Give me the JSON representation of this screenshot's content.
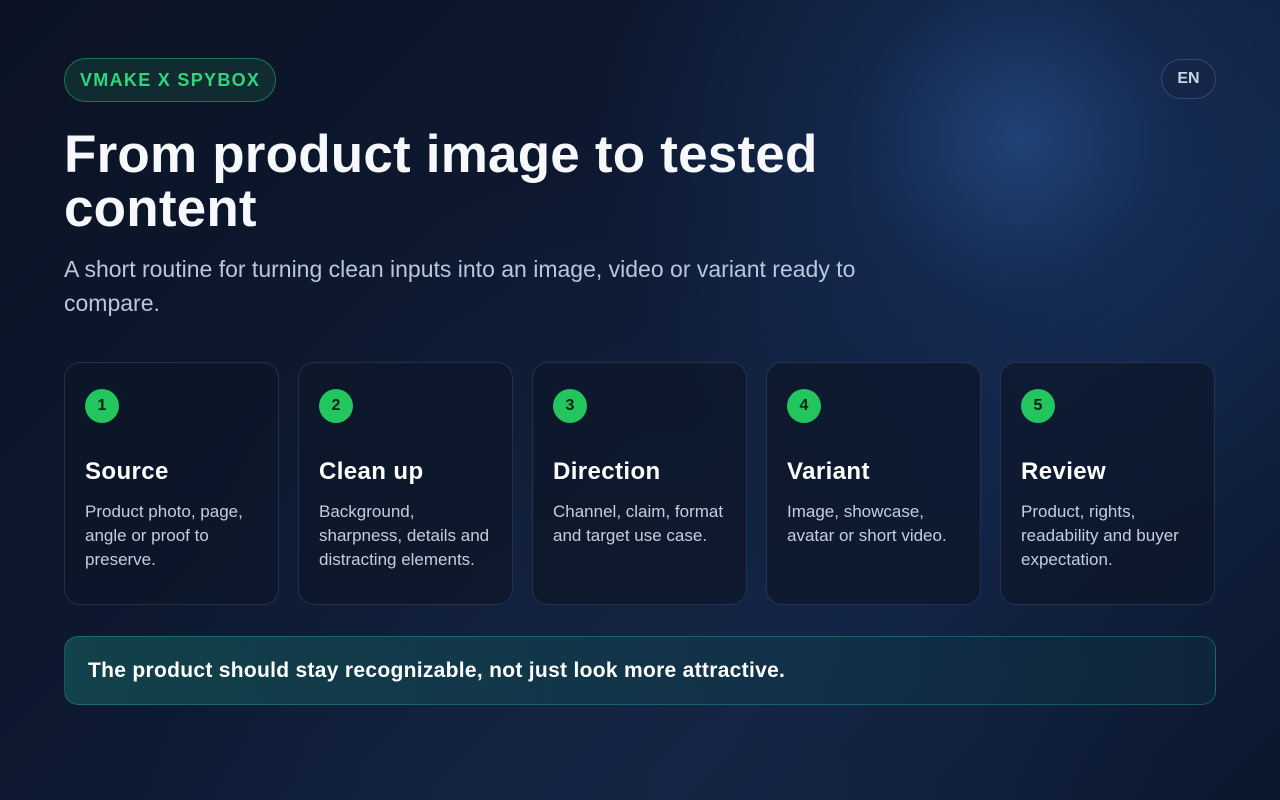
{
  "header": {
    "badge": "VMAKE X SPYBOX",
    "language": "EN"
  },
  "hero": {
    "title": "From product image to tested content",
    "subtitle": "A short routine for turning clean inputs into an image, video or variant ready to compare."
  },
  "steps": [
    {
      "number": "1",
      "title": "Source",
      "text": "Product photo, page, angle or proof to preserve."
    },
    {
      "number": "2",
      "title": "Clean up",
      "text": "Background, sharpness, details and distracting elements."
    },
    {
      "number": "3",
      "title": "Direction",
      "text": "Channel, claim, format and target use case."
    },
    {
      "number": "4",
      "title": "Variant",
      "text": "Image, showcase, avatar or short video."
    },
    {
      "number": "5",
      "title": "Review",
      "text": "Product, rights, readability and buyer expectation."
    }
  ],
  "note": "The product should stay recognizable, not just look more attractive.",
  "colors": {
    "accent": "#22c55e",
    "background": "#0e1a33"
  }
}
